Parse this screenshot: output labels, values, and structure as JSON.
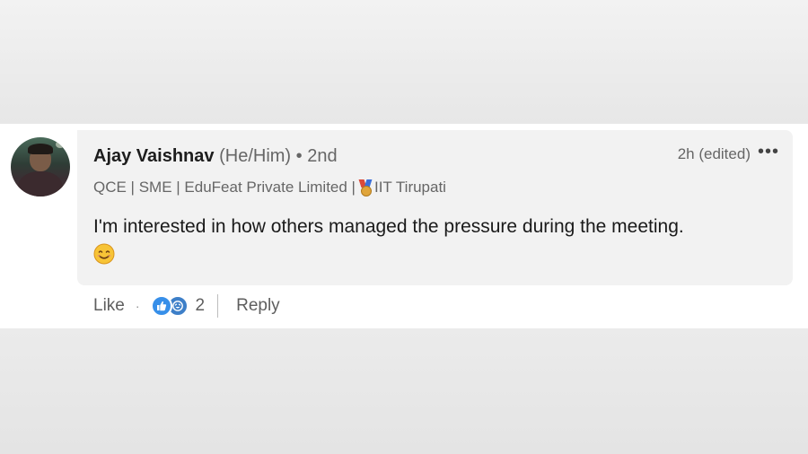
{
  "comment": {
    "author": {
      "name": "Ajay Vaishnav",
      "pronouns": "(He/Him)",
      "degree": "• 2nd",
      "headline_before": "QCE | SME | EduFeat Private Limited |",
      "headline_after": "IIT Tirupati"
    },
    "time": "2h (edited)",
    "more_icon": "•••",
    "text": "I'm interested in how others managed the pressure during the meeting.",
    "emoji": "smiling-face-icon"
  },
  "actions": {
    "like_label": "Like",
    "separator": "·",
    "reaction_count": "2",
    "reply_label": "Reply",
    "reaction_icons": [
      "like-reaction-icon",
      "funny-reaction-icon"
    ]
  },
  "colors": {
    "bubble": "#f2f2f2",
    "like_reaction": "#378fe9",
    "text_secondary": "#666666"
  }
}
